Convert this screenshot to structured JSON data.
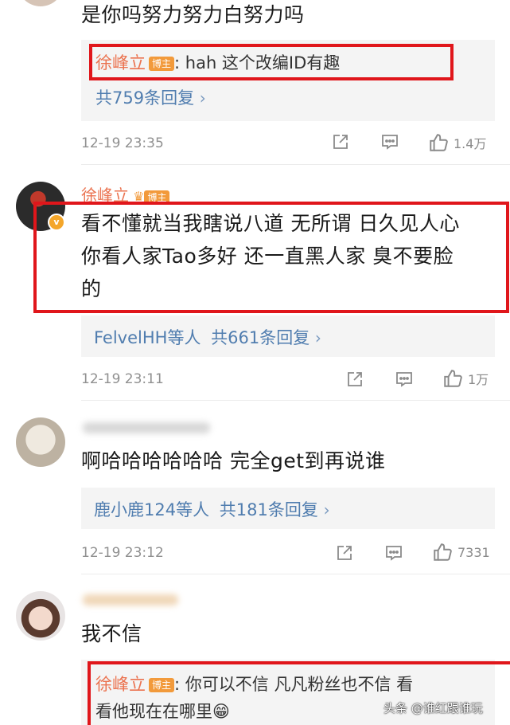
{
  "comments": [
    {
      "text": "是你吗努力努力白努力吗",
      "reply_author": "徐峰立",
      "reply_badge": "博主",
      "reply_text": ": hah 这个改编ID有趣",
      "reply_count": "共759条回复",
      "time": "12-19 23:35",
      "likes": "1.4万"
    },
    {
      "author": "徐峰立",
      "author_badge": "博主",
      "text_lines": [
        "看不懂就当我瞎说八道 无所谓 日久见人心",
        "你看人家Tao多好 还一直黑人家 臭不要脸",
        "的"
      ],
      "reply_users": "FelvelHH等人",
      "reply_count": "共661条回复",
      "time": "12-19 23:11",
      "likes": "1万"
    },
    {
      "text": "啊哈哈哈哈哈哈 完全get到再说谁",
      "reply_users": "鹿小鹿124等人",
      "reply_count": "共181条回复",
      "time": "12-19 23:12",
      "likes": "7331"
    },
    {
      "text": "我不信",
      "reply_author": "徐峰立",
      "reply_badge": "博主",
      "reply_text_1": ": 你可以不信 凡凡粉丝也不信 看",
      "reply_text_2": "看他现在在哪里😁"
    }
  ],
  "chevron": "›",
  "watermark": "头条 @谁红跟谁玩",
  "colors": {
    "highlight_border": "#e0161b",
    "link_blue": "#507daf",
    "author_orange": "#eb7350"
  }
}
